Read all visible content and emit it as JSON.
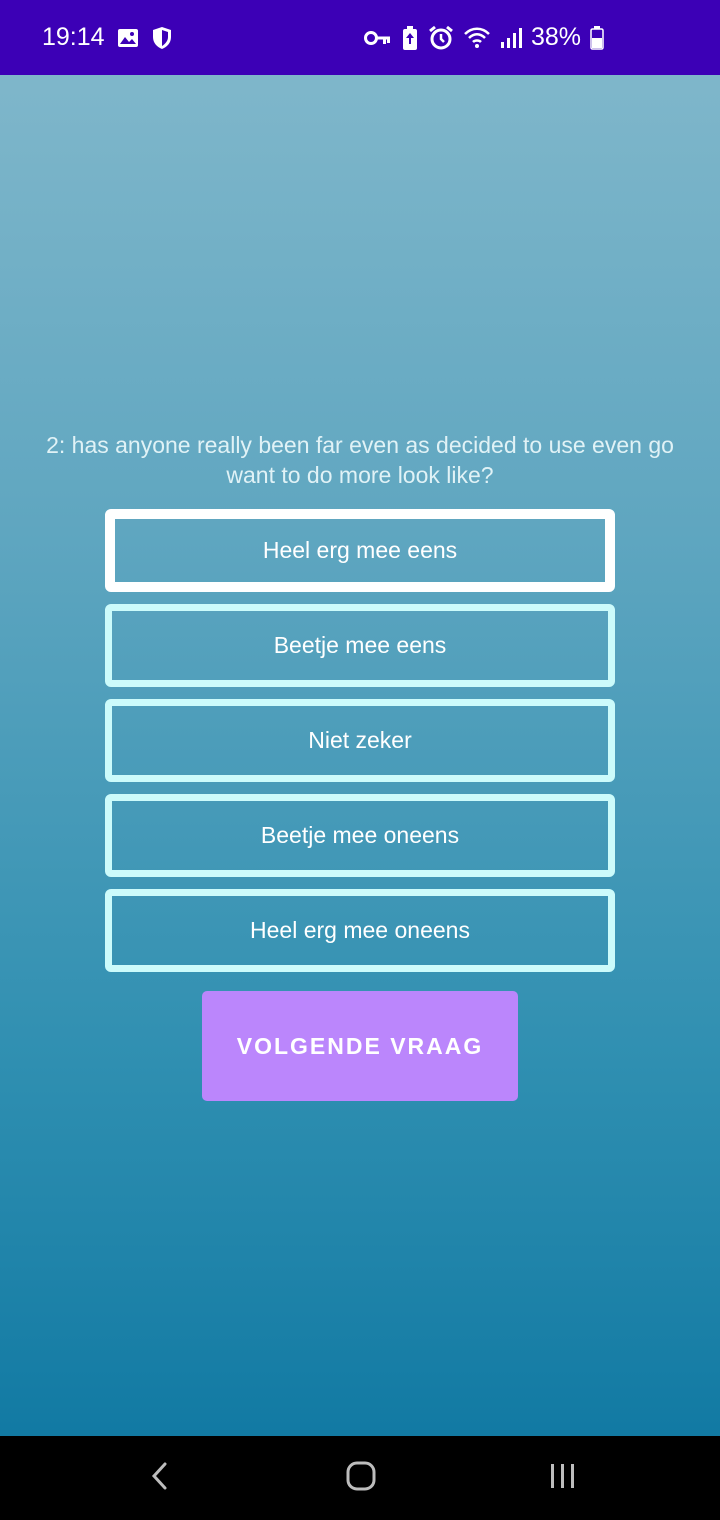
{
  "status_bar": {
    "time": "19:14",
    "battery": "38%",
    "left_icons": [
      "image-icon",
      "shield-icon"
    ],
    "right_icons": [
      "key-icon",
      "battery-saver-icon",
      "alarm-icon",
      "wifi-icon",
      "signal-icon",
      "battery-icon"
    ],
    "background": "#3c00b6"
  },
  "question": {
    "text": "2: has anyone really been far even as decided to use even go want to do more look like?"
  },
  "options": [
    {
      "label": "Heel erg mee eens",
      "selected": true
    },
    {
      "label": "Beetje mee eens",
      "selected": false
    },
    {
      "label": "Niet zeker",
      "selected": false
    },
    {
      "label": "Beetje mee oneens",
      "selected": false
    },
    {
      "label": "Heel erg mee oneens",
      "selected": false
    }
  ],
  "next_button": {
    "label": "VOLGENDE VRAAG",
    "color": "#bb86fc"
  },
  "nav_bar": {
    "icons": [
      "back-icon",
      "home-icon",
      "recents-icon"
    ]
  },
  "colors": {
    "option_border": "#ccfbfb",
    "selected_border": "#ffffff",
    "gradient_top": "#84b9cc",
    "gradient_bottom": "#0b75a0"
  }
}
